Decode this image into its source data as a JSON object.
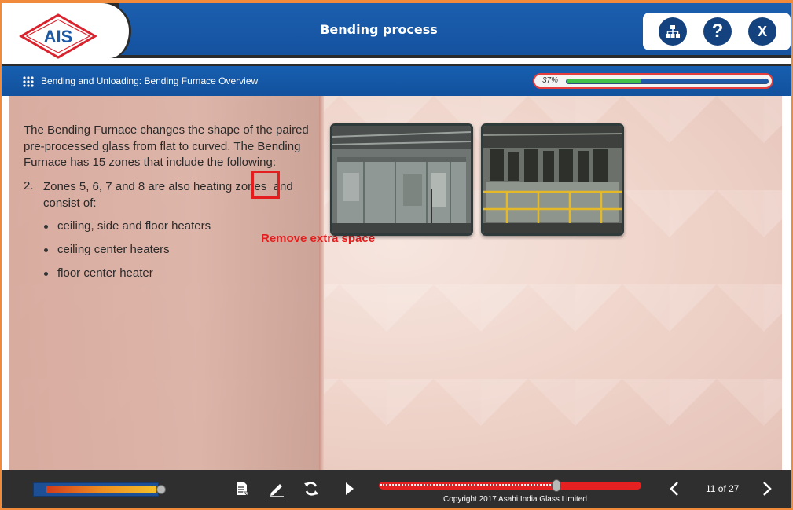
{
  "app": {
    "logo_text": "AIS",
    "title": "Bending process"
  },
  "header_buttons": [
    {
      "name": "sitemap",
      "label": ""
    },
    {
      "name": "help",
      "label": "?"
    },
    {
      "name": "close",
      "label": "X"
    }
  ],
  "subheader": {
    "breadcrumb": "Bending and Unloading: Bending Furnace Overview",
    "progress_label": "37%",
    "progress_value": 0.37
  },
  "content": {
    "intro": "The Bending Furnace changes the shape of the paired pre-processed glass from flat to curved. The Bending Furnace has 15 zones that include the following:",
    "list_number": "2.",
    "list_item": "Zones 5, 6, 7 and 8 are also heating zones  and consist of:",
    "bullets": [
      "ceiling, side and floor heaters",
      "ceiling center heaters",
      "floor center heater"
    ],
    "annotation": "Remove extra space"
  },
  "footer": {
    "copyright": "Copyright 2017 Asahi India Glass Limited",
    "page_indicator": "11 of 27",
    "seek_position": 0.68
  },
  "colors": {
    "header_blue": "#1b5fae",
    "accent_red": "#e41e1e",
    "progress_green": "#41c04a",
    "frame_orange": "#f28a3c"
  }
}
